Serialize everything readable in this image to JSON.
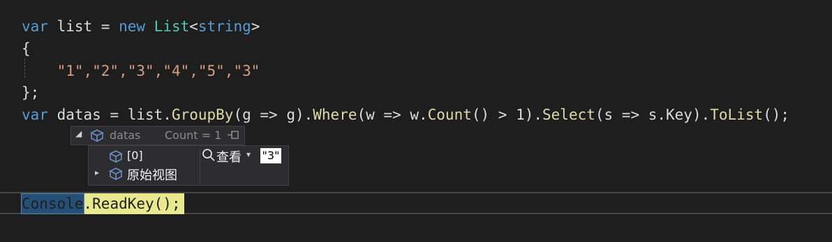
{
  "code": {
    "line1": {
      "kw_var": "var",
      "ident": " list = ",
      "kw_new": "new",
      "type_list": " List",
      "lt": "<",
      "kw_string": "string",
      "gt": ">"
    },
    "line2": "{",
    "line3": {
      "indent": "    ",
      "strings": "\"1\",\"2\",\"3\",\"4\",\"5\",\"3\""
    },
    "line4": "};",
    "line5": {
      "kw_var": "var",
      "part1": " datas = list.",
      "groupby": "GroupBy",
      "part2": "(g => g).",
      "where": "Where",
      "part3": "(w => w.",
      "count": "Count",
      "part4": "() > 1).",
      "select": "Select",
      "part5": "(s => s.Key).",
      "tolist": "ToList",
      "part6": "();"
    },
    "line6": {
      "console": "Console",
      "rest": ".ReadKey();"
    }
  },
  "datatip": {
    "header": {
      "expand_glyph": "◢",
      "name": "datas",
      "count": "Count = 1"
    },
    "rows": [
      {
        "label": "[0]"
      },
      {
        "label": "原始视图",
        "expand_glyph": "▸"
      }
    ],
    "viewer": {
      "label": "查看",
      "caret": "▾",
      "value": "\"3\""
    }
  },
  "colors": {
    "keyword": "#569cd6",
    "type": "#4ec9b0",
    "string": "#d69d85",
    "method": "#dcdcaa",
    "selection": "#264f78",
    "highlight": "#e8e890",
    "background": "#1e1e1e"
  },
  "icons": [
    "cube-icon",
    "pin-icon",
    "search-icon",
    "caret-down-icon",
    "expand-arrow-icon"
  ]
}
